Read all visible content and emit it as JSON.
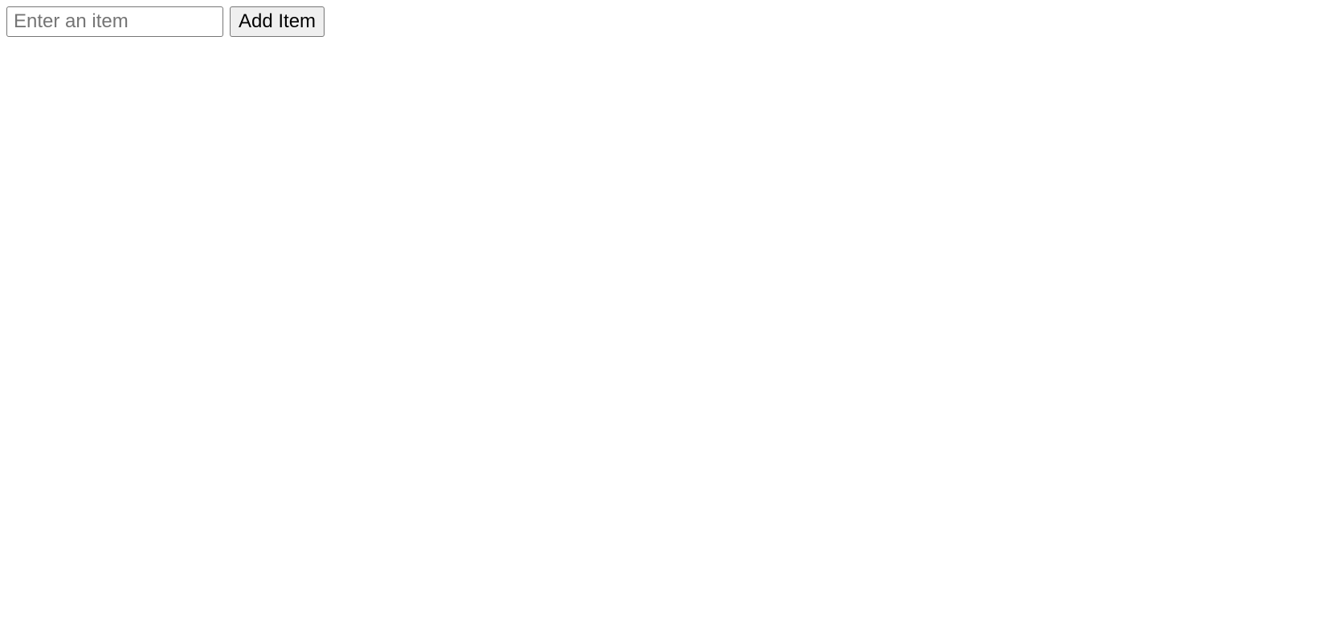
{
  "form": {
    "input_placeholder": "Enter an item",
    "input_value": "",
    "button_label": "Add Item"
  }
}
